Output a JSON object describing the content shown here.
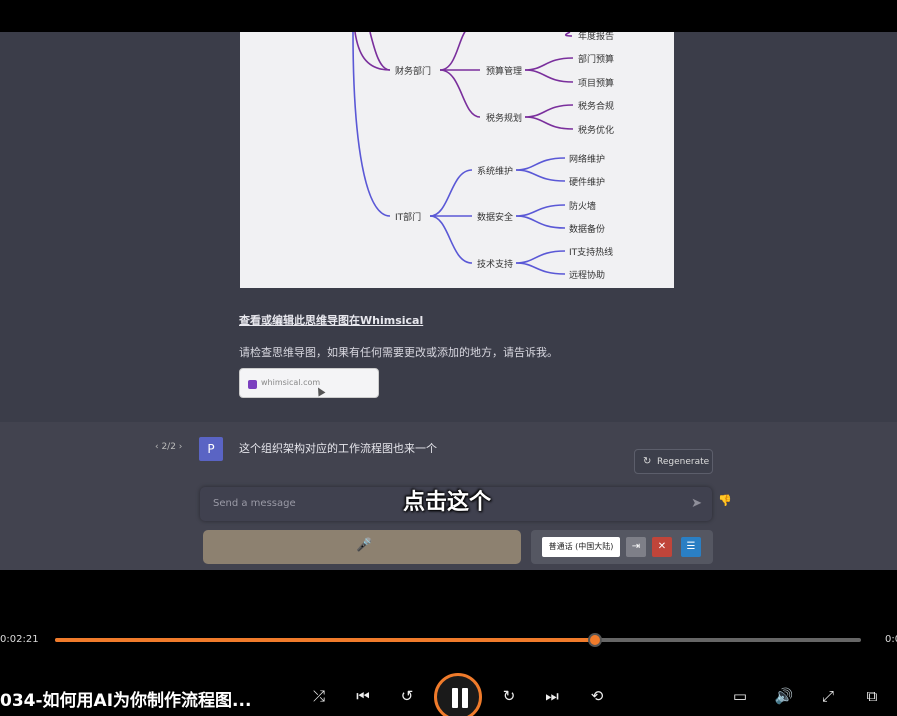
{
  "mindmap": {
    "top_leaf": "年度报告",
    "dept_finance": "财务部门",
    "finance_children": [
      {
        "label": "预算管理",
        "leaves": [
          "部门预算",
          "项目预算"
        ]
      },
      {
        "label": "税务规划",
        "leaves": [
          "税务合规",
          "税务优化"
        ]
      }
    ],
    "dept_it": "IT部门",
    "it_children": [
      {
        "label": "系统维护",
        "leaves": [
          "网络维护",
          "硬件维护"
        ]
      },
      {
        "label": "数据安全",
        "leaves": [
          "防火墙",
          "数据备份"
        ]
      },
      {
        "label": "技术支持",
        "leaves": [
          "IT支持热线",
          "远程协助"
        ]
      }
    ]
  },
  "chat": {
    "view_link": "查看或编辑此思维导图在Whimsical",
    "paragraph": "请检查思维导图，如果有任何需要更改或添加的地方，请告诉我。",
    "link_card_url": "whimsical.com",
    "pager": "‹ 2/2 ›",
    "avatar_letter": "P",
    "user_message": "这个组织架构对应的工作流程图也来一个",
    "regenerate": "Regenerate",
    "input_placeholder": "Send a message"
  },
  "subtitle": "点击这个",
  "voice_tools": {
    "language": "普通话 (中国大陆)"
  },
  "player": {
    "time_current": "0:02:21",
    "time_total": "0:0",
    "progress": 0.67,
    "title": "034-如何用AI为你制作流程图..."
  },
  "colors": {
    "progress": "#f07b2b",
    "finance_branch": "#7a2f9c",
    "it_branch": "#5a58d6"
  },
  "icons": [
    "mic-icon",
    "send-icon",
    "regenerate-icon",
    "shuffle-icon",
    "prev-icon",
    "rewind-10-icon",
    "pause-icon",
    "forward-30-icon",
    "next-icon",
    "repeat-off-icon",
    "subtitles-icon",
    "volume-icon",
    "fullscreen-icon",
    "pip-icon"
  ]
}
